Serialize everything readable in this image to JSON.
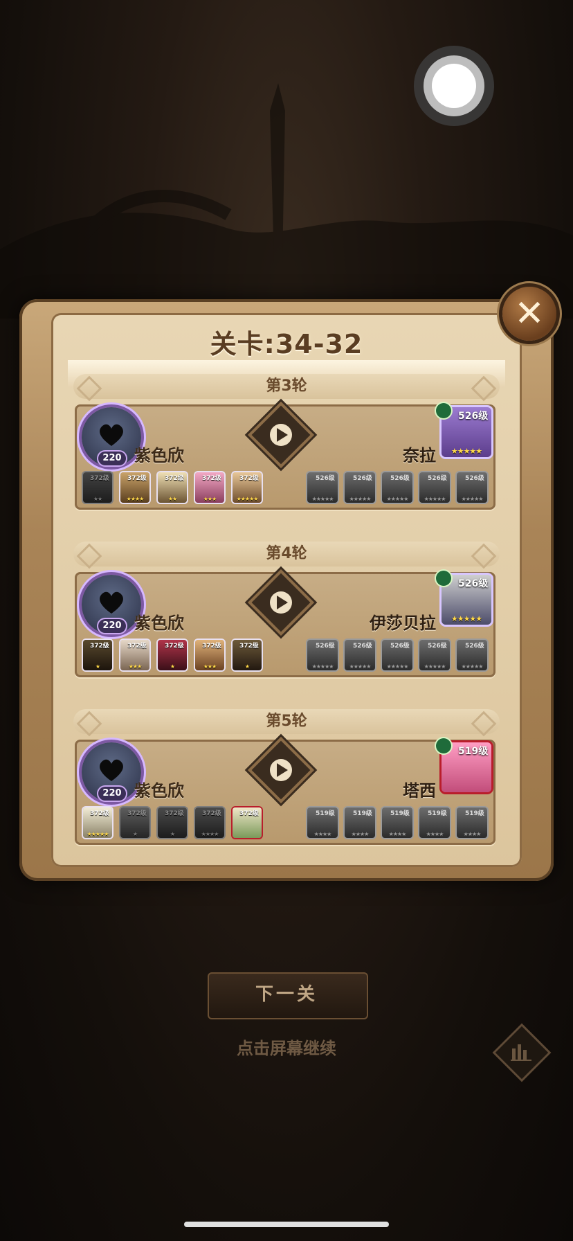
{
  "title": "关卡:34-32",
  "close_label": "✕",
  "rounds": [
    {
      "label": "第3轮",
      "player": {
        "name": "紫色欣",
        "level": "220"
      },
      "enemy": {
        "name": "奈拉",
        "level": "526级",
        "stars": "★★★★★"
      },
      "heroes": [
        {
          "level": "372级",
          "stars": "★★",
          "alive": false
        },
        {
          "level": "372级",
          "stars": "★★★★",
          "alive": true
        },
        {
          "level": "372级",
          "stars": "★★",
          "alive": true
        },
        {
          "level": "372级",
          "stars": "★★★",
          "alive": true
        },
        {
          "level": "372级",
          "stars": "★★★★★",
          "alive": true
        }
      ],
      "enemies": [
        {
          "level": "526级",
          "stars": "★★★★★"
        },
        {
          "level": "526级",
          "stars": "★★★★★"
        },
        {
          "level": "526级",
          "stars": "★★★★★"
        },
        {
          "level": "526级",
          "stars": "★★★★★"
        },
        {
          "level": "526级",
          "stars": "★★★★★"
        }
      ]
    },
    {
      "label": "第4轮",
      "player": {
        "name": "紫色欣",
        "level": "220"
      },
      "enemy": {
        "name": "伊莎贝拉",
        "level": "526级",
        "stars": "★★★★★"
      },
      "heroes": [
        {
          "level": "372级",
          "stars": "★",
          "alive": true
        },
        {
          "level": "372级",
          "stars": "★★★",
          "alive": true
        },
        {
          "level": "372级",
          "stars": "★",
          "alive": true
        },
        {
          "level": "372级",
          "stars": "★★★",
          "alive": true
        },
        {
          "level": "372级",
          "stars": "★",
          "alive": true
        }
      ],
      "enemies": [
        {
          "level": "526级",
          "stars": "★★★★★"
        },
        {
          "level": "526级",
          "stars": "★★★★★"
        },
        {
          "level": "526级",
          "stars": "★★★★★"
        },
        {
          "level": "526级",
          "stars": "★★★★★"
        },
        {
          "level": "526级",
          "stars": "★★★★★"
        }
      ]
    },
    {
      "label": "第5轮",
      "player": {
        "name": "紫色欣",
        "level": "220"
      },
      "enemy": {
        "name": "塔西",
        "level": "519级",
        "stars": ""
      },
      "heroes": [
        {
          "level": "372级",
          "stars": "★★★★★",
          "alive": true
        },
        {
          "level": "372级",
          "stars": "★",
          "alive": false
        },
        {
          "level": "372级",
          "stars": "★",
          "alive": false
        },
        {
          "level": "372级",
          "stars": "★★★★",
          "alive": false
        },
        {
          "level": "372级",
          "stars": "",
          "alive": true
        }
      ],
      "enemies": [
        {
          "level": "519级",
          "stars": "★★★★"
        },
        {
          "level": "519级",
          "stars": "★★★★"
        },
        {
          "level": "519级",
          "stars": "★★★★"
        },
        {
          "level": "519级",
          "stars": "★★★★"
        },
        {
          "level": "519级",
          "stars": "★★★★"
        }
      ]
    }
  ],
  "next_button": "下一关",
  "tap_hint": "点击屏幕继续",
  "colors": {
    "panel": "#e2cea9",
    "frame": "#a98457",
    "text_dark": "#3c2a18",
    "star": "#ffd84a"
  }
}
